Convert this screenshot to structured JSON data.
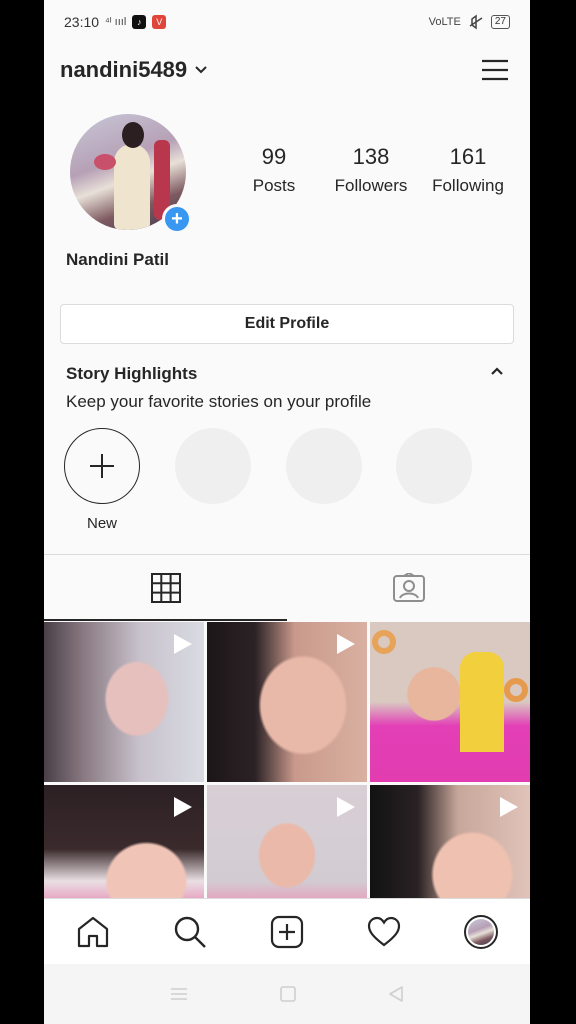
{
  "status_bar": {
    "time": "23:10",
    "signal_text": "⁴ᴵ ıııl",
    "tiktok_glyph": "♪",
    "vivaldi_glyph": "V",
    "network": "VoLTE",
    "battery": "27"
  },
  "header": {
    "username": "nandini5489"
  },
  "profile": {
    "stats": [
      {
        "value": "99",
        "label": "Posts"
      },
      {
        "value": "138",
        "label": "Followers"
      },
      {
        "value": "161",
        "label": "Following"
      }
    ],
    "full_name": "Nandini Patil",
    "edit_button": "Edit Profile",
    "add_badge": "+"
  },
  "highlights": {
    "title": "Story Highlights",
    "subtitle": "Keep your favorite stories on your profile",
    "new_label": "New"
  },
  "tabs": [
    {
      "icon": "grid-icon",
      "active": true
    },
    {
      "icon": "tagged-icon",
      "active": false
    }
  ],
  "posts": [
    {
      "type": "video"
    },
    {
      "type": "video"
    },
    {
      "type": "image"
    },
    {
      "type": "video"
    },
    {
      "type": "video"
    },
    {
      "type": "video"
    }
  ],
  "bottom_nav": [
    "home-icon",
    "search-icon",
    "add-post-icon",
    "activity-heart-icon",
    "profile-avatar"
  ],
  "colors": {
    "accent_blue": "#3897f0",
    "text": "#262626",
    "border": "#dbdbdb",
    "background": "#fafafa"
  }
}
